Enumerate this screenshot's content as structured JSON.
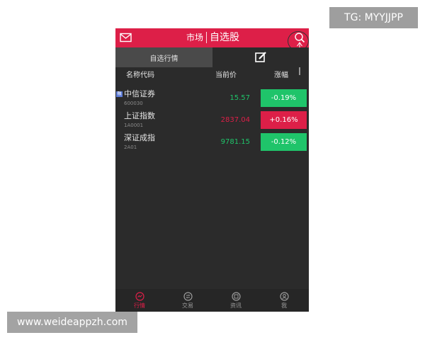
{
  "header": {
    "market_label": "市场",
    "title": "自选股",
    "color": "#dd1f48"
  },
  "tabs": {
    "active_label": "自选行情",
    "edit_icon": "edit-icon"
  },
  "columns": {
    "name": "名称代码",
    "price": "当前价",
    "change": "涨幅"
  },
  "stocks": [
    {
      "badge": "融",
      "name": "中信证券",
      "code": "600030",
      "price": "15.57",
      "change": "-0.19%",
      "direction": "down"
    },
    {
      "badge": "",
      "name": "上证指数",
      "code": "1A0001",
      "price": "2837.04",
      "change": "+0.16%",
      "direction": "up"
    },
    {
      "badge": "",
      "name": "深证成指",
      "code": "2A01",
      "price": "9781.15",
      "change": "-0.12%",
      "direction": "down"
    }
  ],
  "colors": {
    "up": "#dd1f48",
    "down": "#1fc46a",
    "active_nav": "#dd1f48"
  },
  "bottom_nav": [
    {
      "label": "行情",
      "icon": "chart-icon",
      "active": true
    },
    {
      "label": "交易",
      "icon": "trade-icon",
      "active": false
    },
    {
      "label": "资讯",
      "icon": "news-icon",
      "active": false
    },
    {
      "label": "我",
      "icon": "user-icon",
      "active": false
    }
  ],
  "watermarks": {
    "top": "TG: MYYJJPP",
    "bottom": "www.weideappzh.com"
  }
}
